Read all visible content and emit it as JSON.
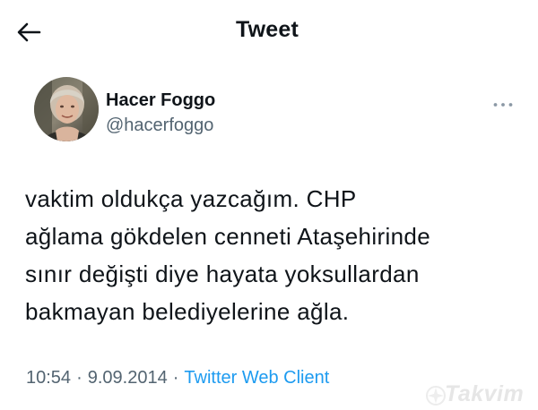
{
  "header": {
    "title": "Tweet",
    "back_icon": "arrow-left-icon"
  },
  "author": {
    "name": "Hacer Foggo",
    "handle": "@hacerfoggo",
    "avatar_icon": "profile-photo",
    "more_icon": "more-horizontal-icon"
  },
  "tweet": {
    "lines": [
      "vaktim oldukça yazcağım. CHP",
      "ağlama gökdelen cenneti Ataşehirinde",
      "sınır değişti diye hayata yoksullardan",
      "bakmayan belediyelerine ağla."
    ],
    "time": "10:54",
    "date": "9.09.2014",
    "separator": "·",
    "client": "Twitter Web Client"
  },
  "watermark": {
    "logo": "Takvim"
  },
  "colors": {
    "text": "#0f1419",
    "secondary": "#536471",
    "link": "#1d9bf0",
    "background": "#ffffff"
  }
}
